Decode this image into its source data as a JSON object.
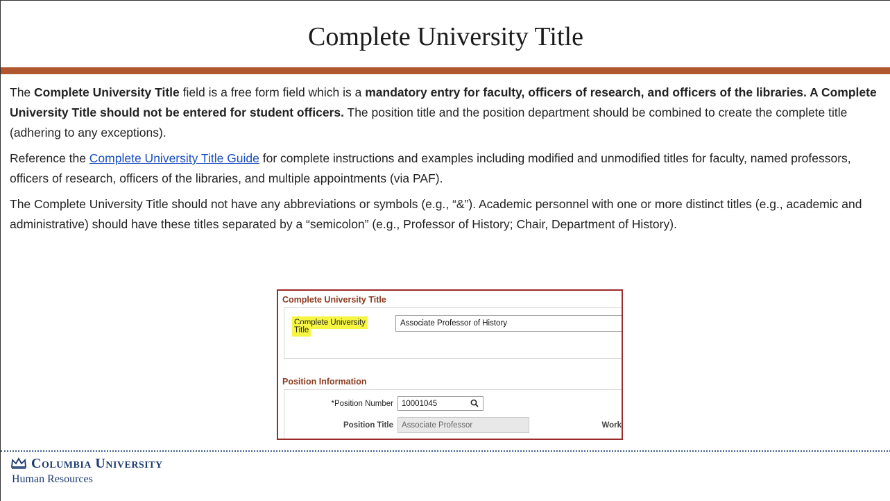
{
  "slide": {
    "title": "Complete University Title",
    "accent_color": "#b0572f"
  },
  "body": {
    "p1": {
      "s1": "The ",
      "b1": "Complete University Title",
      "s2": " field is a free form field which is a ",
      "b2": "mandatory entry for faculty, officers of research, and officers of the libraries. A Complete University Title should not be entered for student officers.",
      "s3": " The position title and the position department should be combined to create the complete title (adhering to any exceptions)."
    },
    "p2": {
      "s1": "Reference the ",
      "link": "Complete University Title Guide",
      "s2": " for complete instructions and examples including modified and unmodified titles for faculty, named professors, officers of research, officers of the libraries, and multiple appointments (via PAF)."
    },
    "p3": "The Complete University Title should not have any abbreviations or symbols (e.g., “&”). Academic personnel with one or more distinct titles (e.g., academic and administrative) should have these titles separated by a “semicolon” (e.g., Professor of History; Chair, Department of History)."
  },
  "screenshot": {
    "section1_title": "Complete University Title",
    "cut_label_line1": "Complete University",
    "cut_label_line2": "Title",
    "cut_value": "Associate Professor of History",
    "section2_title": "Position Information",
    "position_number_label": "*Position Number",
    "position_number_value": "10001045",
    "position_title_label": "Position Title",
    "position_title_value": "Associate Professor",
    "work_label": "Work"
  },
  "footer": {
    "org_name": "Columbia University",
    "org_sub": "Human Resources"
  }
}
